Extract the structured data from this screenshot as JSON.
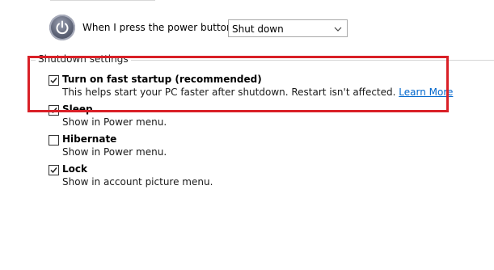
{
  "power_button": {
    "label": "When I press the power button:",
    "dropdown_value": "Shut down"
  },
  "shutdown_settings": {
    "title": "Shutdown settings",
    "options": [
      {
        "title": "Turn on fast startup (recommended)",
        "description": "This helps start your PC faster after shutdown. Restart isn't affected.",
        "link": "Learn More",
        "checked": true
      },
      {
        "title": "Sleep",
        "description": "Show in Power menu.",
        "checked": true
      },
      {
        "title": "Hibernate",
        "description": "Show in Power menu.",
        "checked": false
      },
      {
        "title": "Lock",
        "description": "Show in account picture menu.",
        "checked": true
      }
    ]
  },
  "colors": {
    "highlight": "#d92027",
    "link": "#0066cc",
    "accent": "#333333"
  },
  "icons": {
    "power": "power-icon",
    "dropdown": "chevron-down-icon",
    "check": "checkmark-icon"
  }
}
